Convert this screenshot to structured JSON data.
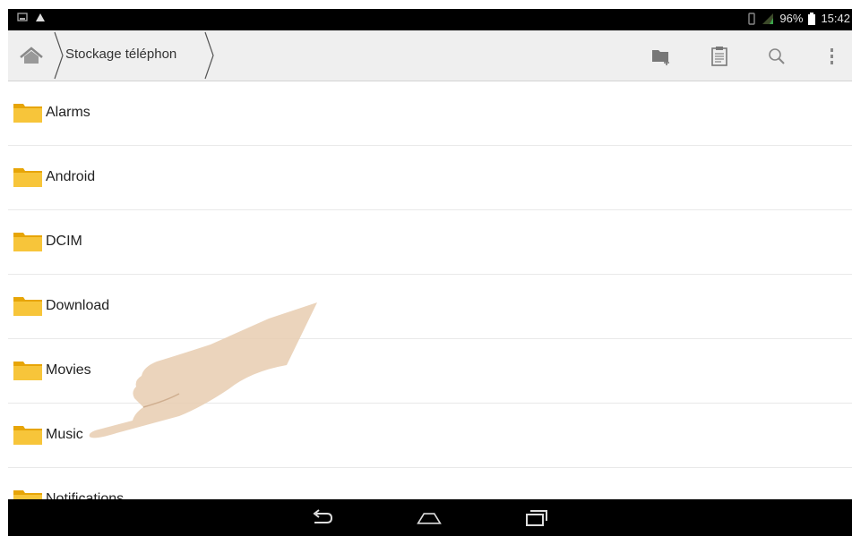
{
  "status": {
    "battery_percent": "96%",
    "time": "15:42",
    "icons": [
      "screenshot-icon",
      "warning-icon",
      "vibrate-icon",
      "signal-icon",
      "battery-icon"
    ]
  },
  "toolbar": {
    "breadcrumb": "Stockage téléphon",
    "icons": [
      "home-icon",
      "new-folder-icon",
      "clipboard-icon",
      "search-icon",
      "overflow-menu-icon"
    ]
  },
  "folders": [
    {
      "name": "Alarms"
    },
    {
      "name": "Android"
    },
    {
      "name": "DCIM"
    },
    {
      "name": "Download"
    },
    {
      "name": "Movies"
    },
    {
      "name": "Music"
    },
    {
      "name": "Notifications"
    }
  ],
  "navbar": {
    "icons": [
      "back-icon",
      "home-nav-icon",
      "recents-icon"
    ]
  },
  "colors": {
    "folder": "#f2b30e",
    "toolbar_bg": "#efefef",
    "statusbar_bg": "#000000"
  }
}
